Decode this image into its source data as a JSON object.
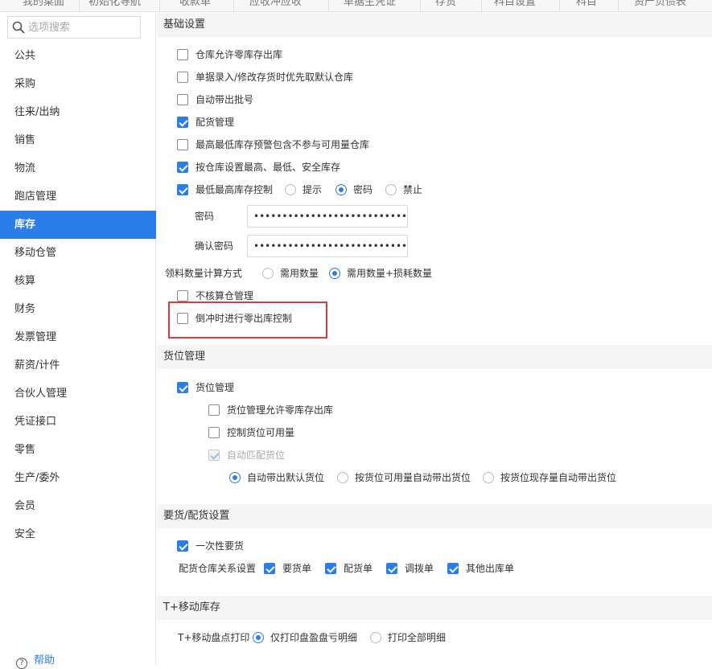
{
  "topbar": {
    "tabs": [
      "我的桌面",
      "初始化导航",
      "收款单",
      "应收冲应收",
      "单据生凭证",
      "存货",
      "科目设置",
      "科目",
      "资产负债表"
    ]
  },
  "sidebar": {
    "search_placeholder": "选项搜索",
    "items": [
      "公共",
      "采购",
      "往来/出纳",
      "销售",
      "物流",
      "跑店管理",
      "库存",
      "移动仓管",
      "核算",
      "财务",
      "发票管理",
      "薪资/计件",
      "合伙人管理",
      "凭证接口",
      "零售",
      "生产/委外",
      "会员",
      "安全"
    ],
    "active": "库存",
    "help_label": "帮助"
  },
  "basic": {
    "title": "基础设置",
    "opt1": "仓库允许零库存出库",
    "opt2": "单据录入/修改存货时优先取默认仓库",
    "opt3": "自动带出批号",
    "opt4": "配货管理",
    "opt5": "最高最低库存预警包含不参与可用量仓库",
    "opt6": "按仓库设置最高、最低、安全库存",
    "opt7": "最低最高库存控制",
    "ctrl_opt1": "提示",
    "ctrl_opt2": "密码",
    "ctrl_opt3": "禁止",
    "pwd_label": "密码",
    "pwd_value": "••••••••••••••••••••••••••••••••",
    "confirm_label": "确认密码",
    "confirm_value": "••••••••••••••••••••••••••••••••",
    "calc_label": "领料数量计算方式",
    "calc_opt1": "需用数量",
    "calc_opt2": "需用数量+损耗数量",
    "opt8": "不核算仓管理",
    "opt9": "倒冲时进行零出库控制"
  },
  "location": {
    "title": "货位管理",
    "opt1": "货位管理",
    "sub1": "货位管理允许零库存出库",
    "sub2": "控制货位可用量",
    "sub3": "自动匹配货位",
    "r1": "自动带出默认货位",
    "r2": "按货位可用量自动带出货位",
    "r3": "按货位现存量自动带出货位"
  },
  "request": {
    "title": "要货/配货设置",
    "opt1": "一次性要货",
    "rel_label": "配货仓库关系设置",
    "c1": "要货单",
    "c2": "配货单",
    "c3": "调拨单",
    "c4": "其他出库单"
  },
  "mobile": {
    "title": "T+移动库存",
    "print_label": "T+移动盘点打印",
    "r1": "仅打印盘盈盘亏明细",
    "r2": "打印全部明细"
  },
  "colors": {
    "accent": "#2b7de9",
    "highlight_border": "#e23a3a",
    "section_bg": "#f5f5f5"
  }
}
